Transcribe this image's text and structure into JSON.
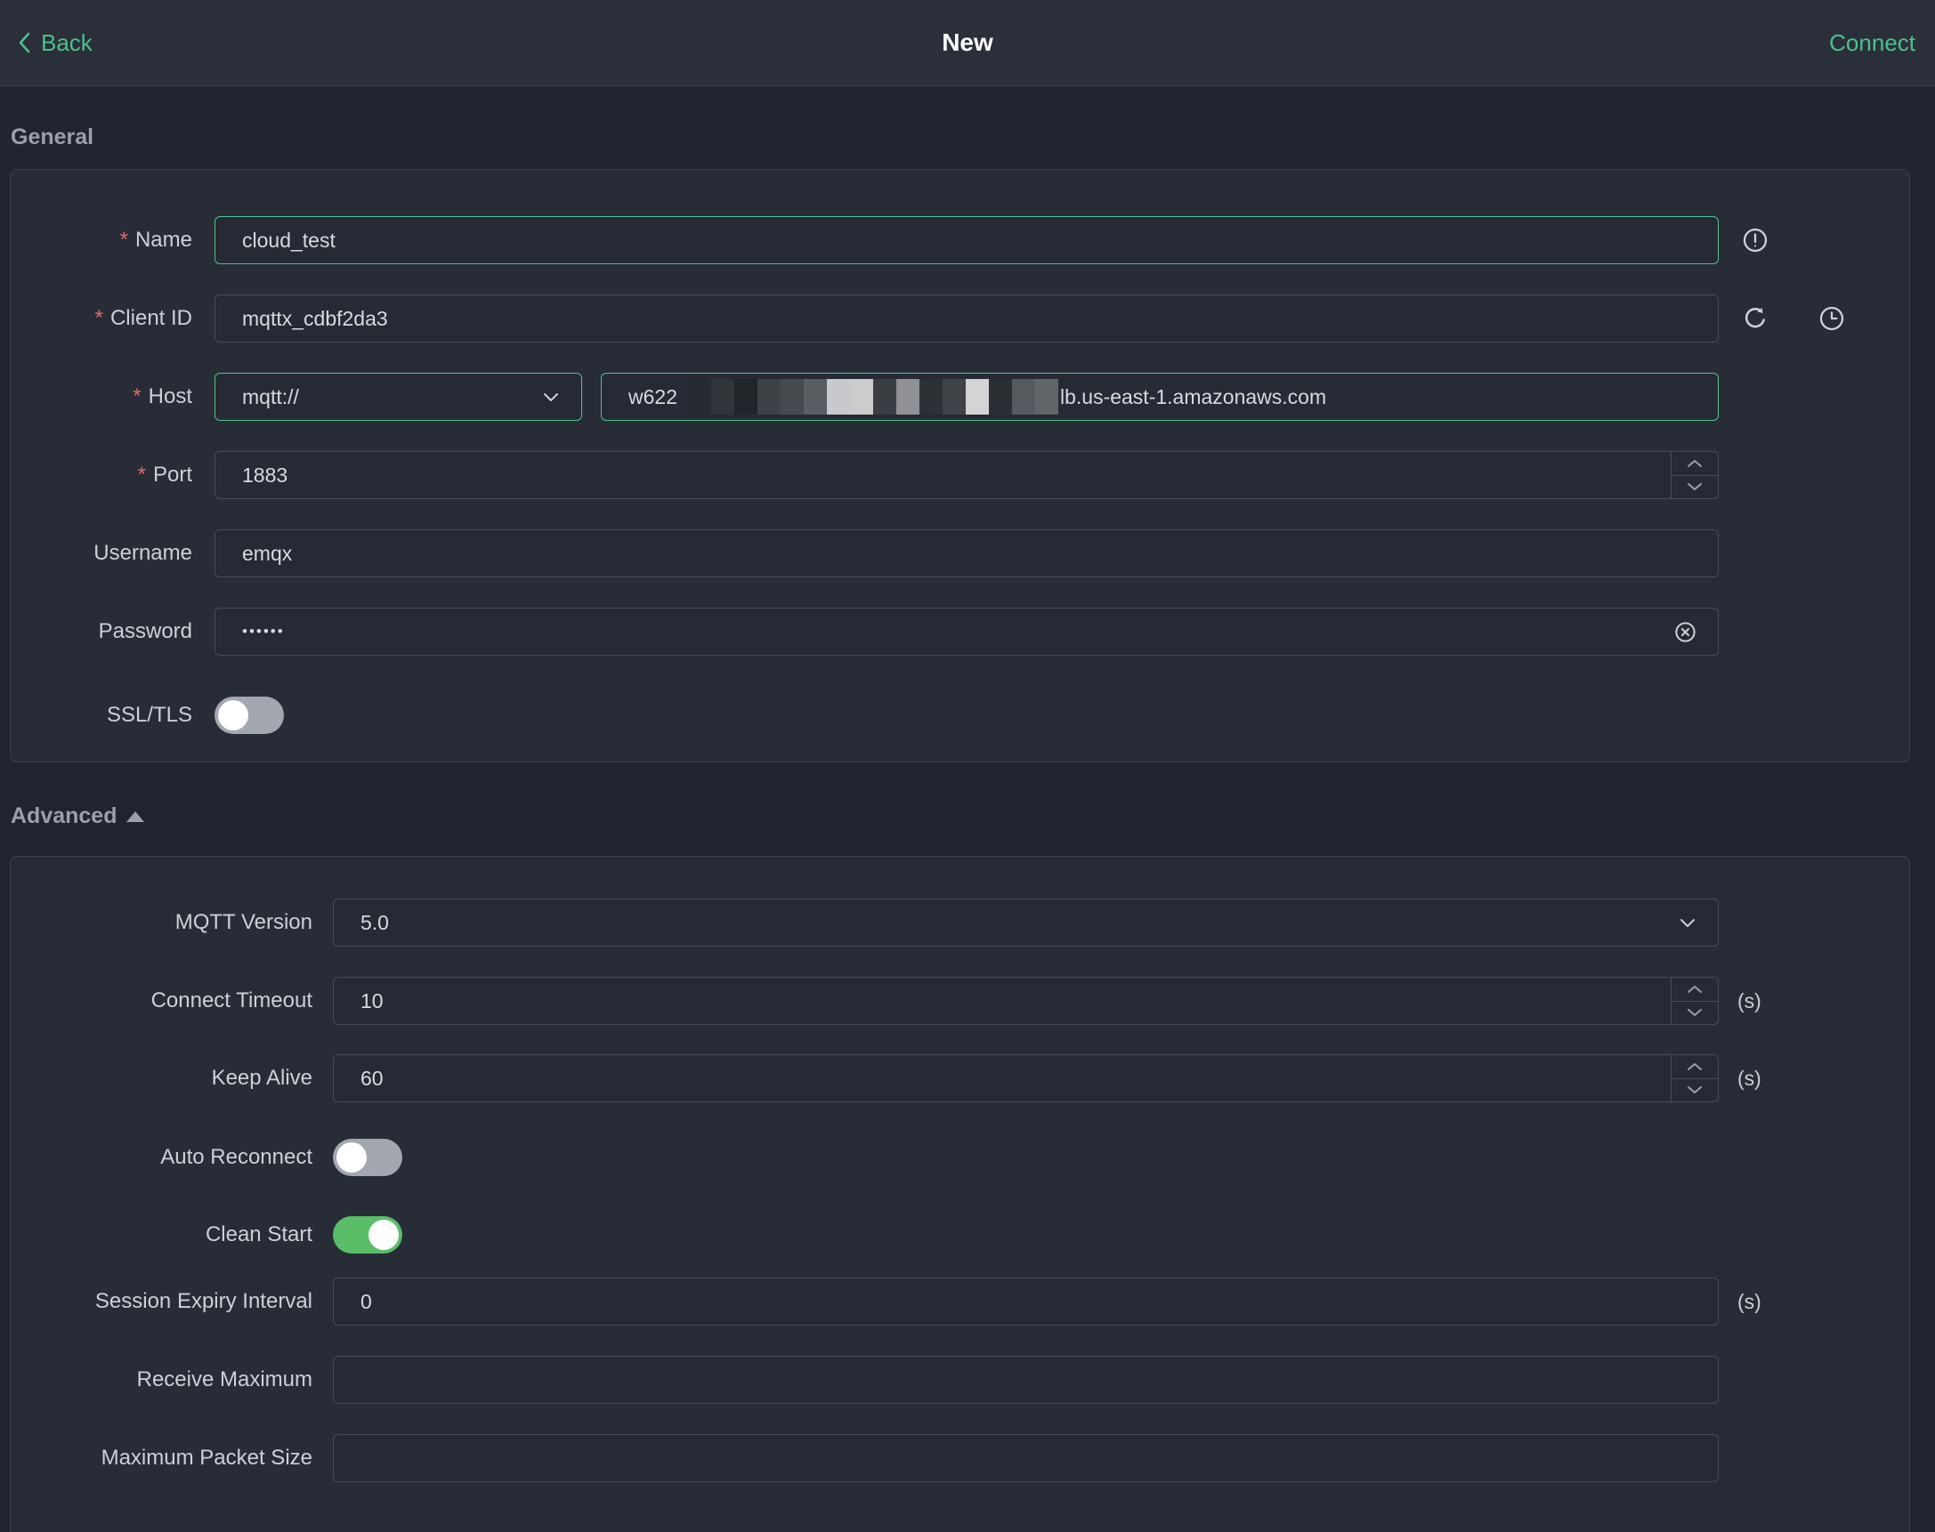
{
  "header": {
    "back_label": "Back",
    "title": "New",
    "connect_label": "Connect"
  },
  "required_marker": "*",
  "colors": {
    "accent_green": "#4dc08b",
    "focus_border_green": "#4ec58c",
    "toggle_on_green": "#5abe68",
    "required_red": "#e06a6a",
    "page_background": "#20242e",
    "card_background": "#272c36"
  },
  "icons": {
    "back": "chevron-left-icon",
    "name_hint": "exclamation-circle-icon",
    "client_id_refresh": "refresh-icon",
    "client_id_history": "clock-icon",
    "password_clear": "circle-x-icon",
    "select_arrow": "chevron-down-icon",
    "advanced_collapse": "triangle-up-icon"
  },
  "general": {
    "section_title": "General",
    "name": {
      "label": "Name",
      "required": true,
      "value": "cloud_test"
    },
    "client_id": {
      "label": "Client ID",
      "required": true,
      "value": "mqttx_cdbf2da3"
    },
    "host": {
      "label": "Host",
      "required": true,
      "protocol": "mqtt://",
      "value_prefix": "w622",
      "value_suffix": "lb.us-east-1.amazonaws.com",
      "redacted": true,
      "redacted_blocks": [
        "#26292f",
        "#303338",
        "#212429",
        "#3e4146",
        "#46494e",
        "#595c60",
        "#c7c9cc",
        "#caccce",
        "#3a3d42",
        "#8f9194",
        "#2d3035",
        "#3f4247",
        "#d3d4d6",
        "#2b2e33",
        "#56595d",
        "#626568"
      ]
    },
    "port": {
      "label": "Port",
      "required": true,
      "value": "1883"
    },
    "username": {
      "label": "Username",
      "required": false,
      "value": "emqx"
    },
    "password": {
      "label": "Password",
      "required": false,
      "value": "••••••"
    },
    "ssl": {
      "label": "SSL/TLS",
      "enabled": false
    }
  },
  "advanced": {
    "section_title": "Advanced",
    "mqtt_version": {
      "label": "MQTT Version",
      "value": "5.0"
    },
    "connect_timeout": {
      "label": "Connect Timeout",
      "value": "10",
      "unit": "(s)"
    },
    "keep_alive": {
      "label": "Keep Alive",
      "value": "60",
      "unit": "(s)"
    },
    "auto_reconnect": {
      "label": "Auto Reconnect",
      "enabled": false
    },
    "clean_start": {
      "label": "Clean Start",
      "enabled": true
    },
    "session_expiry": {
      "label": "Session Expiry Interval",
      "value": "0",
      "unit": "(s)"
    },
    "receive_maximum": {
      "label": "Receive Maximum",
      "value": ""
    },
    "maximum_packet_size": {
      "label": "Maximum Packet Size",
      "value": ""
    }
  }
}
